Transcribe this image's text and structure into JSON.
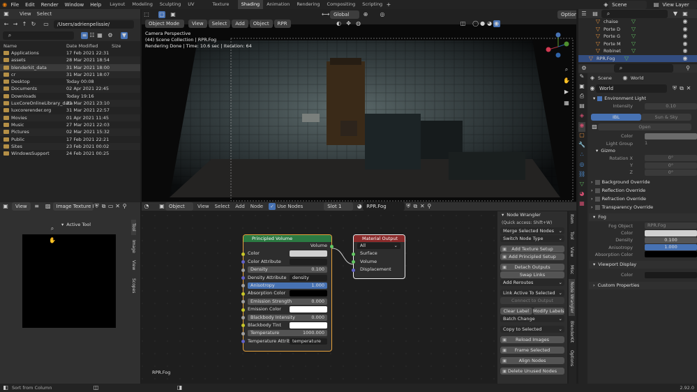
{
  "topbar": {
    "menus": [
      "File",
      "Edit",
      "Render",
      "Window",
      "Help"
    ],
    "workspaces": [
      "Layout",
      "Modeling",
      "Sculpting",
      "UV Editing",
      "Texture Paint",
      "Shading",
      "Animation",
      "Rendering",
      "Compositing",
      "Scripting"
    ],
    "active_workspace": "Shading",
    "scene": "Scene",
    "view_layer": "View Layer"
  },
  "filebrowser": {
    "menus": [
      "View",
      "Select"
    ],
    "path": "/Users/adrienpelissie/",
    "col_name": "Name",
    "col_date": "Date Modified",
    "col_size": "Size",
    "rows": [
      {
        "name": "Applications",
        "date": "17 Feb 2021 22:31"
      },
      {
        "name": "assets",
        "date": "28 Mar 2021 18:54"
      },
      {
        "name": "blenderkit_data",
        "date": "31 Mar 2021 18:00"
      },
      {
        "name": "cr",
        "date": "31 Mar 2021 18:07"
      },
      {
        "name": "Desktop",
        "date": "Today 00:08"
      },
      {
        "name": "Documents",
        "date": "02 Apr 2021 22:45"
      },
      {
        "name": "Downloads",
        "date": "Today 19:16"
      },
      {
        "name": "LuxCoreOnlineLibrary_data",
        "date": "31 Mar 2021 23:10"
      },
      {
        "name": "luxcorerender.org",
        "date": "31 Mar 2021 22:57"
      },
      {
        "name": "Movies",
        "date": "01 Apr 2021 11:45"
      },
      {
        "name": "Music",
        "date": "27 Mar 2021 22:03"
      },
      {
        "name": "Pictures",
        "date": "02 Mar 2021 15:32"
      },
      {
        "name": "Public",
        "date": "17 Feb 2021 22:21"
      },
      {
        "name": "Sites",
        "date": "23 Feb 2021 00:02"
      },
      {
        "name": "WindowsSupport",
        "date": "24 Feb 2021 00:25"
      }
    ]
  },
  "viewport": {
    "mode": "Object Mode",
    "menus": [
      "View",
      "Select",
      "Add",
      "Object"
    ],
    "engine": "RPR",
    "transform": "Global",
    "options": "Options",
    "overlay_line1": "Camera Perspective",
    "overlay_line2": "(44) Scene Collection | RPR.Fog",
    "overlay_line3": "Rendering Done | Time: 10.6 sec | Iteration: 64"
  },
  "imageeditor": {
    "view": "View",
    "image": "Image Texture Bake...",
    "active_tool": "Active Tool",
    "tabs": [
      "Tool",
      "Image",
      "View",
      "Scopes"
    ]
  },
  "nodeeditor": {
    "mode": "Object",
    "menus": [
      "View",
      "Select",
      "Add",
      "Node"
    ],
    "use_nodes": "Use Nodes",
    "slot": "Slot 1",
    "material": "RPR.Fog",
    "footer": "RPR.Fog",
    "pv": {
      "title": "Principled Volume",
      "out": "Volume",
      "color": "Color",
      "color_attr": "Color Attribute",
      "density_label": "Density",
      "density": "0.100",
      "density_attr_label": "Density Attribute",
      "density_attr": "density",
      "aniso_label": "Anisotropy",
      "aniso": "1.000",
      "abs_color": "Absorption Color",
      "emi_strength_label": "Emission Strength",
      "emi_strength": "0.000",
      "emi_color": "Emission Color",
      "bb_int_label": "Blackbody Intensity",
      "bb_int": "0.000",
      "bb_tint": "Blackbody Tint",
      "temp_label": "Temperature",
      "temp": "1000.000",
      "temp_attr_label": "Temperature Attrib...",
      "temp_attr": "temperature"
    },
    "mo": {
      "title": "Material Output",
      "target": "All",
      "surface": "Surface",
      "volume": "Volume",
      "displacement": "Displacement"
    }
  },
  "nodewrangler": {
    "title": "Node Wrangler",
    "quick": "(Quick access: Shift+W)",
    "merge": "Merge Selected Nodes",
    "switch": "Switch Node Type",
    "add_tex": "Add Texture Setup",
    "add_pr": "Add Principled Setup",
    "detach": "Detach Outputs",
    "swap": "Swap Links",
    "add_reroutes": "Add Reroutes",
    "link_active": "Link Active To Selected",
    "connect_out": "Connect to Output",
    "clear_label": "Clear Label",
    "modify_labels": "Modify Labels",
    "batch": "Batch Change",
    "copy_sel": "Copy to Selected",
    "reload": "Reload Images",
    "frame": "Frame Selected",
    "align": "Align Nodes",
    "delete_unused": "Delete Unused Nodes",
    "tabs": [
      "Item",
      "Tool",
      "View",
      "Misc",
      "Node Wrangler",
      "BlenderKit",
      "Options"
    ]
  },
  "outliner": {
    "items": [
      "chaise",
      "Porte D",
      "Porte G",
      "Porte M",
      "Robinet",
      "RPR.Fog"
    ]
  },
  "properties": {
    "scene": "Scene",
    "world_tab": "World",
    "world_name": "World",
    "env_light": "Environment Light",
    "intensity_label": "Intensity",
    "intensity": "0.10",
    "ibl": "IBL",
    "sun_sky": "Sun & Sky",
    "open": "Open",
    "color_label": "Color",
    "light_group_label": "Light Group",
    "light_group": "1",
    "gizmo": "Gizmo",
    "rot_x_label": "Rotation X",
    "rot_x": "0°",
    "y_label": "Y",
    "y": "0°",
    "z_label": "Z",
    "z": "0°",
    "bg_override": "Background Override",
    "refl_override": "Reflection Override",
    "refr_override": "Refraction Override",
    "transp_override": "Transparency Override",
    "fog": "Fog",
    "fog_object_label": "Fog Object",
    "fog_object": "RPR.Fog",
    "fog_color_label": "Color",
    "density_label": "Density",
    "density": "0.100",
    "aniso_label": "Anisotropy",
    "aniso": "1.000",
    "abs_label": "Absorption Color",
    "viewport_display": "Viewport Display",
    "vd_color": "Color",
    "custom_props": "Custom Properties"
  },
  "statusbar": {
    "left": "Sort from Column",
    "version": "2.92.0"
  }
}
